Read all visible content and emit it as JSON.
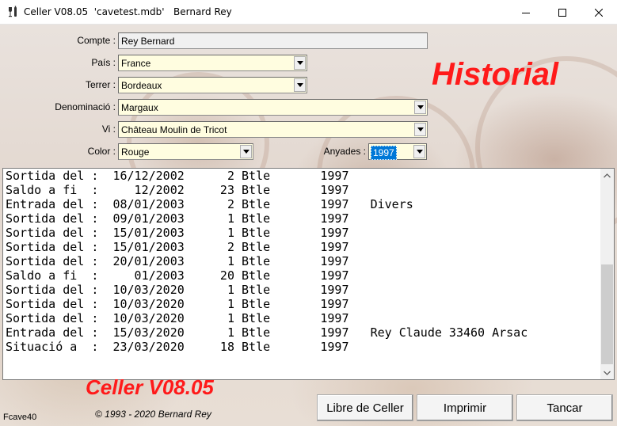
{
  "window": {
    "title": "Celler V08.05  'cavetest.mdb'   Bernard Rey",
    "minimize": "—",
    "maximize": "☐",
    "close": "✕"
  },
  "form": {
    "compte_label": "Compte :",
    "compte_value": "Rey Bernard",
    "pais_label": "País :",
    "pais_value": "France",
    "terrer_label": "Terrer :",
    "terrer_value": "Bordeaux",
    "denominacio_label": "Denominació :",
    "denominacio_value": "Margaux",
    "vi_label": "Vi :",
    "vi_value": "Château Moulin de Tricot",
    "color_label": "Color :",
    "color_value": "Rouge",
    "anyades_label": "Anyades :",
    "anyades_value": "1997"
  },
  "heading": "Historial",
  "history": [
    "Sortida del :  16/12/2002      2 Btle       1997",
    "Saldo a fi  :     12/2002     23 Btle       1997",
    "Entrada del :  08/01/2003      2 Btle       1997   Divers",
    "Sortida del :  09/01/2003      1 Btle       1997",
    "Sortida del :  15/01/2003      1 Btle       1997",
    "Sortida del :  15/01/2003      2 Btle       1997",
    "Sortida del :  20/01/2003      1 Btle       1997",
    "Saldo a fi  :     01/2003     20 Btle       1997",
    "Sortida del :  10/03/2020      1 Btle       1997",
    "Sortida del :  10/03/2020      1 Btle       1997",
    "Sortida del :  10/03/2020      1 Btle       1997",
    "Entrada del :  15/03/2020      1 Btle       1997   Rey Claude 33460 Arsac",
    "Situació a  :  23/03/2020     18 Btle       1997"
  ],
  "footer": {
    "app_name": "Celler V08.05",
    "copyright": "© 1993 - 2020 Bernard Rey",
    "form_id": "Fcave40"
  },
  "buttons": {
    "libre": "Libre de Celler",
    "imprimir": "Imprimir",
    "tancar": "Tancar"
  },
  "colors": {
    "accent_red": "#ff1a1a",
    "field_bg": "#fffde0",
    "selection": "#0078d7"
  }
}
